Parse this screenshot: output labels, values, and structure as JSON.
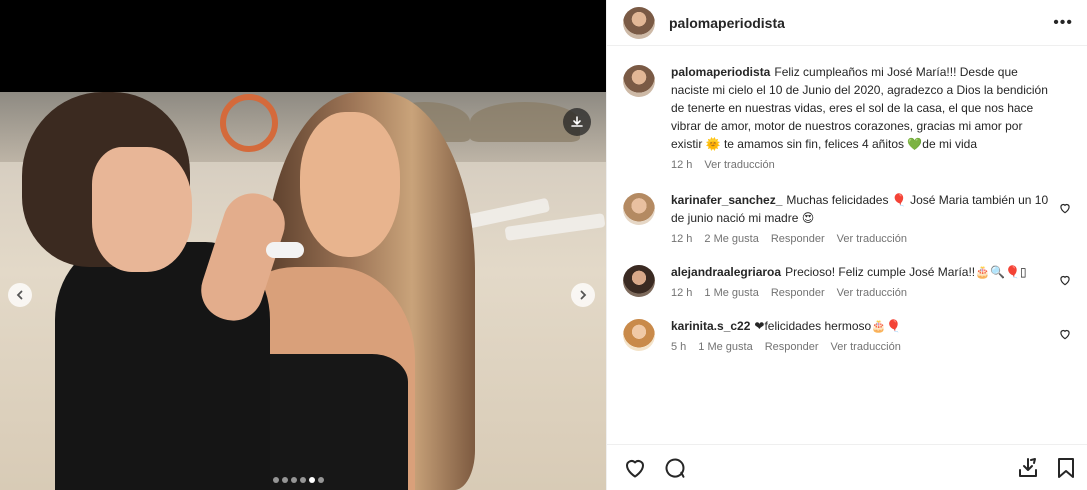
{
  "post": {
    "username": "palomaperiodista",
    "more_label": "•••",
    "image_dots": 6,
    "active_dot": 4
  },
  "caption": {
    "username": "palomaperiodista",
    "text": "Feliz cumpleaños mi José María!!! Desde que naciste mi cielo el 10 de Junio del 2020, agradezco a Dios la bendición de tenerte en nuestras vidas, eres el sol de la casa, el que nos hace vibrar de amor, motor de nuestros corazones, gracias mi amor por existir 🌞 te amamos sin fin, felices 4 añitos 💚de mi vida",
    "time": "12 h",
    "translate": "Ver traducción"
  },
  "comments": [
    {
      "username": "karinafer_sanchez_",
      "text": "Muchas felicidades 🎈 José Maria también un 10 de junio nació mi madre 😍",
      "time": "12 h",
      "likes": "2 Me gusta",
      "reply": "Responder",
      "translate": "Ver traducción"
    },
    {
      "username": "alejandraalegriaroa",
      "text": "Precioso! Feliz cumple José María!!🎂🔍🎈▯",
      "time": "12 h",
      "likes": "1 Me gusta",
      "reply": "Responder",
      "translate": "Ver traducción"
    },
    {
      "username": "karinita.s_c22",
      "text": "❤felicidades hermoso🎂🎈",
      "time": "5 h",
      "likes": "1 Me gusta",
      "reply": "Responder",
      "translate": "Ver traducción"
    }
  ],
  "colors": {
    "text": "#262626",
    "secondary": "#737373",
    "divider": "#efefef"
  }
}
